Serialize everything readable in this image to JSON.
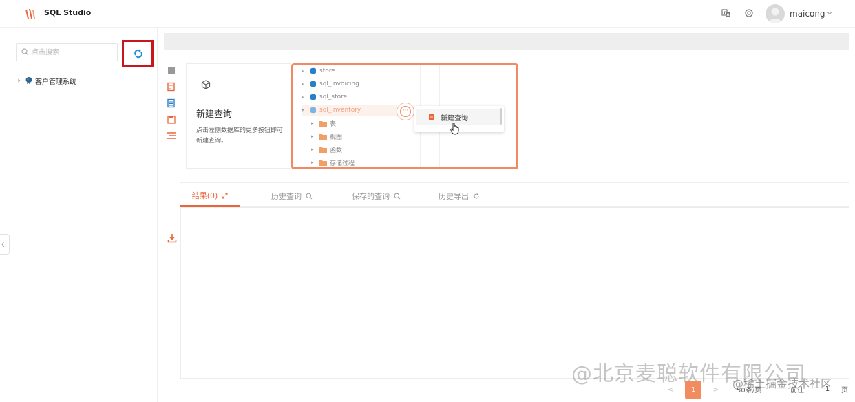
{
  "header": {
    "app_title": "SQL Studio",
    "user_name": "maicong"
  },
  "sidebar": {
    "search_placeholder": "点击搜索",
    "tree": [
      {
        "label": "客户管理系统"
      }
    ]
  },
  "guide": {
    "title": "新建查询",
    "description": "点击左侧数据库的更多按钮即可新建查询。",
    "preview_tree": [
      {
        "label": "store"
      },
      {
        "label": "sql_invoicing"
      },
      {
        "label": "sql_store"
      },
      {
        "label": "sql_inventory"
      }
    ],
    "preview_children": [
      {
        "label": "表"
      },
      {
        "label": "视图"
      },
      {
        "label": "函数"
      },
      {
        "label": "存储过程"
      }
    ],
    "more_button": "···",
    "context_item": "新建查询"
  },
  "tabs": [
    {
      "label": "结果(0)"
    },
    {
      "label": "历史查询"
    },
    {
      "label": "保存的查询"
    },
    {
      "label": "历史导出"
    }
  ],
  "pagination": {
    "prev": "<",
    "current_page": "1",
    "next": ">",
    "page_size": "50条/页",
    "goto_label": "前往",
    "goto_value": "1",
    "page_unit": "页"
  },
  "watermark": {
    "main": "@北京麦聪软件有限公司",
    "sub": "@稀土掘金技术社区"
  },
  "colors": {
    "accent": "#e8673a",
    "highlight_box": "#c8161d",
    "preview_border": "#f08a62"
  }
}
